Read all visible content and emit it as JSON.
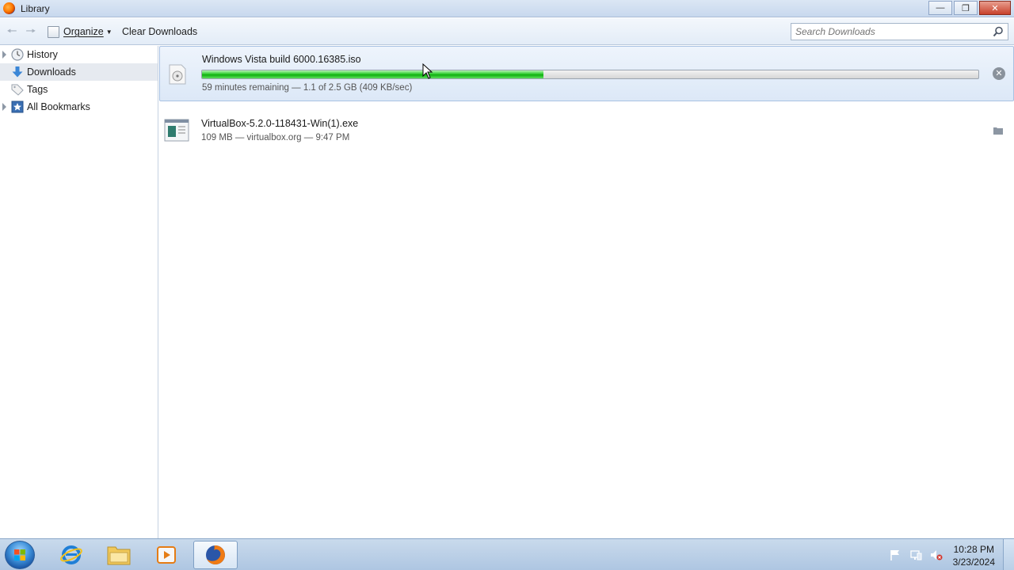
{
  "window": {
    "title": "Library"
  },
  "toolbar": {
    "organize_label": "Organize",
    "clear_downloads_label": "Clear Downloads",
    "search_placeholder": "Search Downloads"
  },
  "sidebar": {
    "items": [
      {
        "label": "History",
        "icon": "clock-icon",
        "expandable": true
      },
      {
        "label": "Downloads",
        "icon": "download-arrow-icon",
        "expandable": false,
        "selected": true
      },
      {
        "label": "Tags",
        "icon": "tag-icon",
        "expandable": false
      },
      {
        "label": "All Bookmarks",
        "icon": "bookmark-star-icon",
        "expandable": true
      }
    ]
  },
  "downloads": [
    {
      "name": "Windows Vista build 6000.16385.iso",
      "status": "59 minutes remaining — 1.1 of 2.5 GB (409 KB/sec)",
      "progress": 0.44,
      "state": "in-progress",
      "icon": "disc-image-icon",
      "action_icon": "cancel-icon"
    },
    {
      "name": "VirtualBox-5.2.0-118431-Win(1).exe",
      "status": "109 MB — virtualbox.org — 9:47 PM",
      "state": "completed",
      "icon": "executable-icon",
      "action_icon": "folder-icon"
    }
  ],
  "taskbar": {
    "apps": [
      "internet-explorer-icon",
      "file-explorer-icon",
      "media-player-icon",
      "firefox-icon"
    ],
    "active_app": "firefox-icon",
    "clock_time": "10:28 PM",
    "clock_date": "3/23/2024"
  },
  "colors": {
    "progress_green": "#2ecc2e",
    "selection_bg": "#e6eaf0",
    "active_row_bg": "#dce8f7"
  }
}
